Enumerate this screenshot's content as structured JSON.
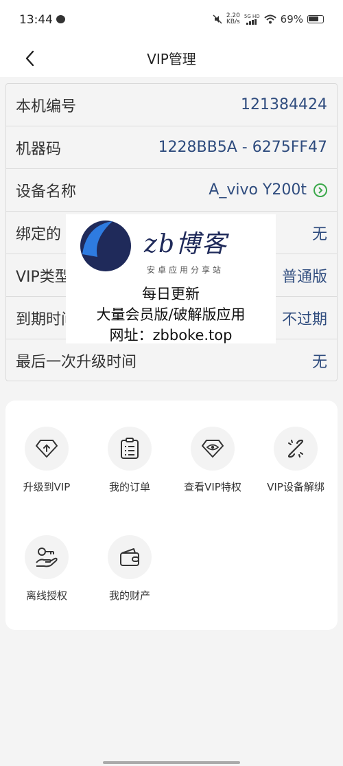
{
  "status_bar": {
    "time": "13:44",
    "speed_value": "2.20",
    "speed_unit": "KB/s",
    "network": "5G HD",
    "battery": "69%"
  },
  "nav": {
    "title": "VIP管理"
  },
  "info": [
    {
      "label": "本机编号",
      "value": "121384424"
    },
    {
      "label": "机器码",
      "value": "1228BB5A - 6275FF47"
    },
    {
      "label": "设备名称",
      "value": "A_vivo Y200t"
    },
    {
      "label": "绑定的",
      "value": "无"
    },
    {
      "label": "VIP类型",
      "value": "普通版"
    },
    {
      "label": "到期时间",
      "value": "不过期"
    },
    {
      "label": "最后一次升级时间",
      "value": "无"
    }
  ],
  "watermark": {
    "brand": "zb博客",
    "subtitle": "安卓应用分享站",
    "lines": [
      "每日更新",
      "大量会员版/破解版应用",
      "网址：zbboke.top"
    ]
  },
  "actions": [
    {
      "label": "升级到VIP",
      "icon": "diamond-upgrade-icon"
    },
    {
      "label": "我的订单",
      "icon": "order-list-icon"
    },
    {
      "label": "查看VIP特权",
      "icon": "vip-privilege-eye-icon"
    },
    {
      "label": "VIP设备解绑",
      "icon": "unlink-icon"
    },
    {
      "label": "离线授权",
      "icon": "offline-key-hand-icon"
    },
    {
      "label": "我的财产",
      "icon": "wallet-icon"
    }
  ],
  "colors": {
    "value_blue": "#2f4c7e",
    "arrow_green": "#3aa84a",
    "brand_navy": "#1f2a5a",
    "logo_blue": "#2e7be0"
  }
}
